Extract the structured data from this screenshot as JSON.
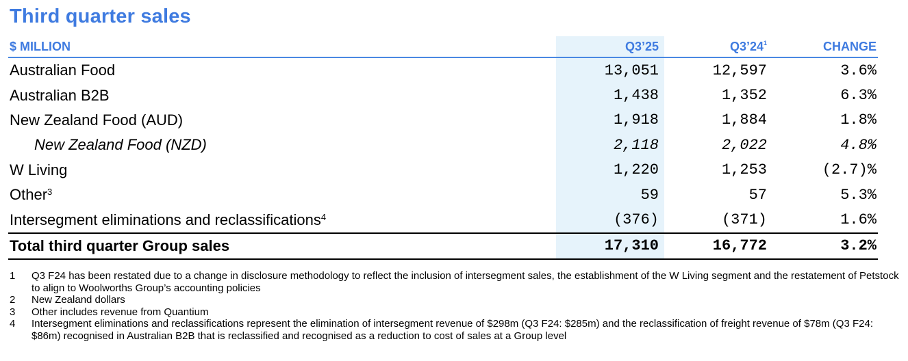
{
  "title": "Third quarter sales",
  "table": {
    "headers": {
      "label": "$ MILLION",
      "q3_25": "Q3’25",
      "q3_24": "Q3’24",
      "q3_24_sup": "1",
      "change": "CHANGE"
    },
    "rows": [
      {
        "label": "Australian Food",
        "sup": "",
        "q3_25": "13,051",
        "q3_24": "12,597",
        "change": "3.6%"
      },
      {
        "label": "Australian B2B",
        "sup": "",
        "q3_25": "1,438",
        "q3_24": "1,352",
        "change": "6.3%"
      },
      {
        "label": "New Zealand Food (AUD)",
        "sup": "",
        "q3_25": "1,918",
        "q3_24": "1,884",
        "change": "1.8%"
      },
      {
        "label": "New Zealand Food (NZD)",
        "sup": "",
        "q3_25": "2,118",
        "q3_24": "2,022",
        "change": "4.8%"
      },
      {
        "label": "W Living",
        "sup": "",
        "q3_25": "1,220",
        "q3_24": "1,253",
        "change": "(2.7)%"
      },
      {
        "label": "Other",
        "sup": "3",
        "q3_25": "59",
        "q3_24": "57",
        "change": "5.3%"
      },
      {
        "label": "Intersegment eliminations and reclassifications",
        "sup": "4",
        "q3_25": "(376)",
        "q3_24": "(371)",
        "change": "1.6%"
      }
    ],
    "total": {
      "label": "Total third quarter Group sales",
      "q3_25": "17,310",
      "q3_24": "16,772",
      "change": "3.2%"
    }
  },
  "notes": [
    {
      "n": "1",
      "text": "Q3 F24 has been restated due to a change in disclosure methodology to reflect the inclusion of intersegment sales, the establishment of the W Living segment and the restatement of Petstock to align to Woolworths Group’s accounting policies"
    },
    {
      "n": "2",
      "text": "New Zealand dollars"
    },
    {
      "n": "3",
      "text": "Other includes revenue from Quantium"
    },
    {
      "n": "4",
      "text": "Intersegment eliminations and reclassifications represent the elimination of intersegment revenue of $298m (Q3 F24: $285m) and the reclassification of freight revenue of $78m (Q3 F24: $86m) recognised in Australian B2B that is reclassified and recognised as a reduction to cost of sales at a Group level"
    }
  ]
}
